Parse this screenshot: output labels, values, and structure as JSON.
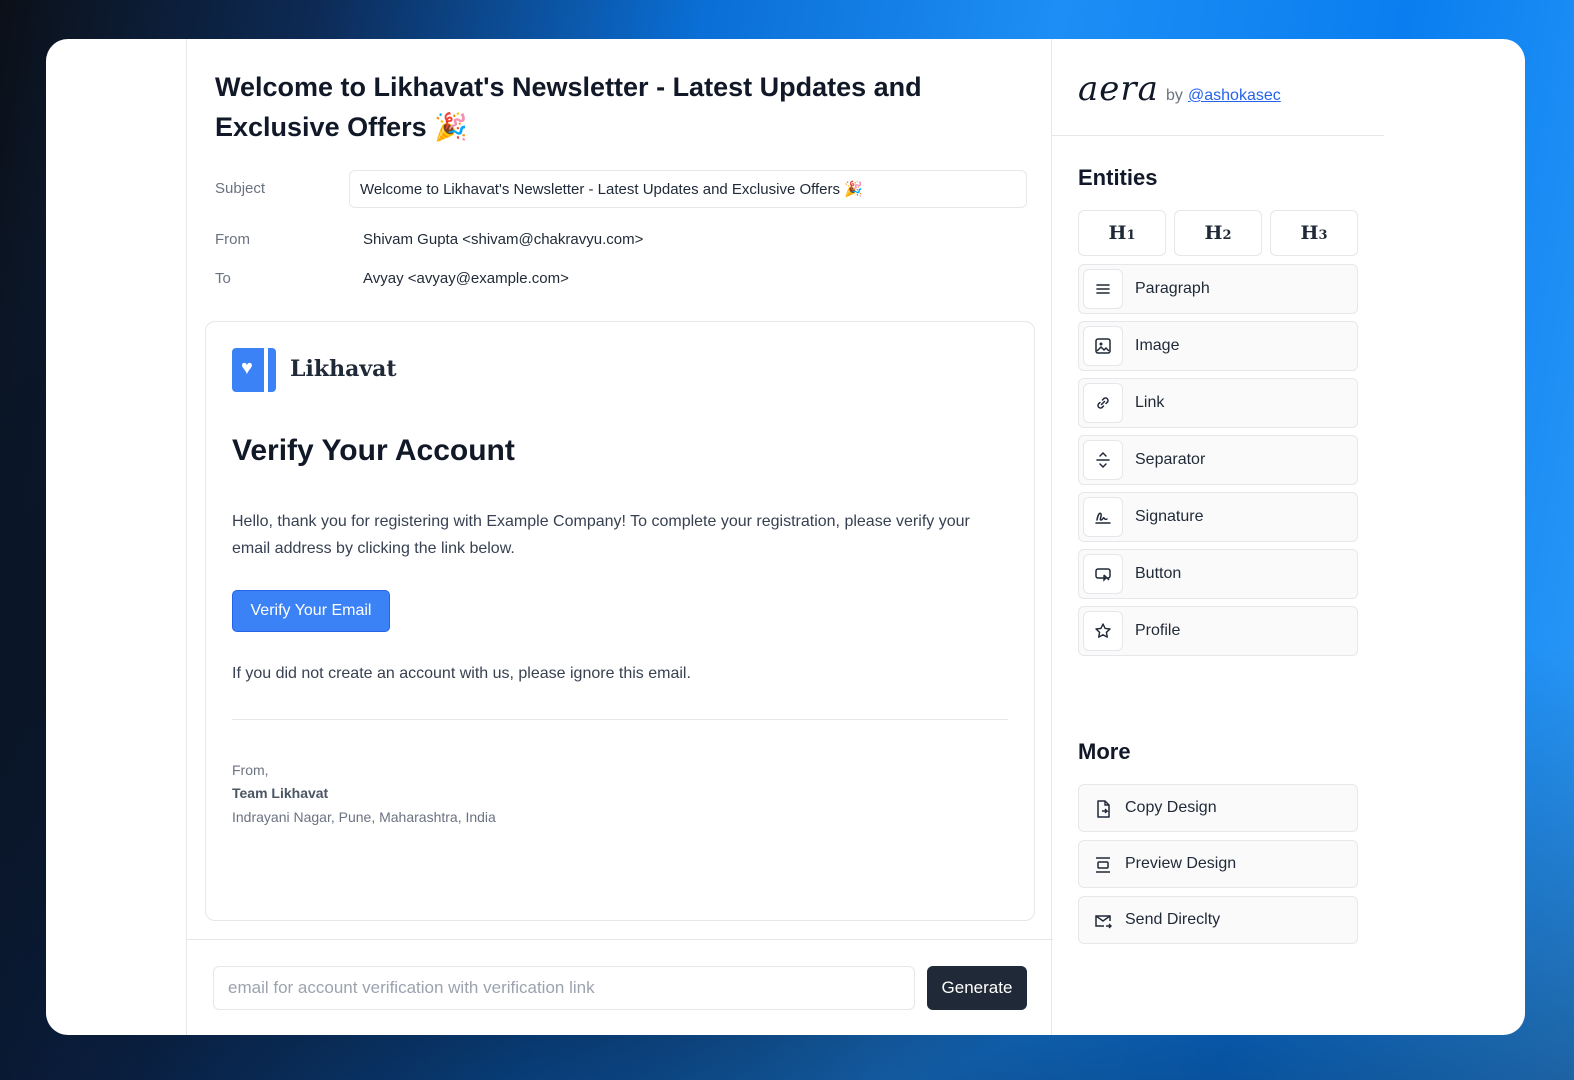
{
  "main": {
    "title": "Welcome to Likhavat's Newsletter - Latest Updates and Exclusive Offers 🎉",
    "subject_label": "Subject",
    "subject_value": "Welcome to Likhavat's Newsletter - Latest Updates and Exclusive Offers 🎉",
    "from_label": "From",
    "from_value": "Shivam Gupta <shivam@chakravyu.com>",
    "to_label": "To",
    "to_value": "Avyay <avyay@example.com>"
  },
  "email": {
    "brand": "Likhavat",
    "heading": "Verify Your Account",
    "body": "Hello, thank you for registering with Example Company! To complete your registration, please verify your email address by clicking the link below.",
    "button_label": "Verify Your Email",
    "ignore_text": "If you did not create an account with us, please ignore this email.",
    "signoff": "From,",
    "team": "Team Likhavat",
    "address": "Indrayani Nagar, Pune, Maharashtra, India"
  },
  "prompt": {
    "placeholder": "email for account verification with verification link",
    "value": "",
    "button_label": "Generate"
  },
  "sidebar": {
    "logo": "aera",
    "by": "by",
    "author": "@ashokasec",
    "entities_title": "Entities",
    "headings": [
      {
        "letter": "H",
        "level": "1"
      },
      {
        "letter": "H",
        "level": "2"
      },
      {
        "letter": "H",
        "level": "3"
      }
    ],
    "entities": [
      {
        "label": "Paragraph",
        "icon": "paragraph-icon"
      },
      {
        "label": "Image",
        "icon": "image-icon"
      },
      {
        "label": "Link",
        "icon": "link-icon"
      },
      {
        "label": "Separator",
        "icon": "separator-icon"
      },
      {
        "label": "Signature",
        "icon": "signature-icon"
      },
      {
        "label": "Button",
        "icon": "button-icon"
      },
      {
        "label": "Profile",
        "icon": "star-icon"
      }
    ],
    "more_title": "More",
    "more": [
      {
        "label": "Copy Design",
        "icon": "copy-icon"
      },
      {
        "label": "Preview Design",
        "icon": "preview-icon"
      },
      {
        "label": "Send Direclty",
        "icon": "send-mail-icon"
      }
    ]
  },
  "colors": {
    "accent": "#3b82f6",
    "dark_button": "#1f2937",
    "link": "#2563eb"
  }
}
